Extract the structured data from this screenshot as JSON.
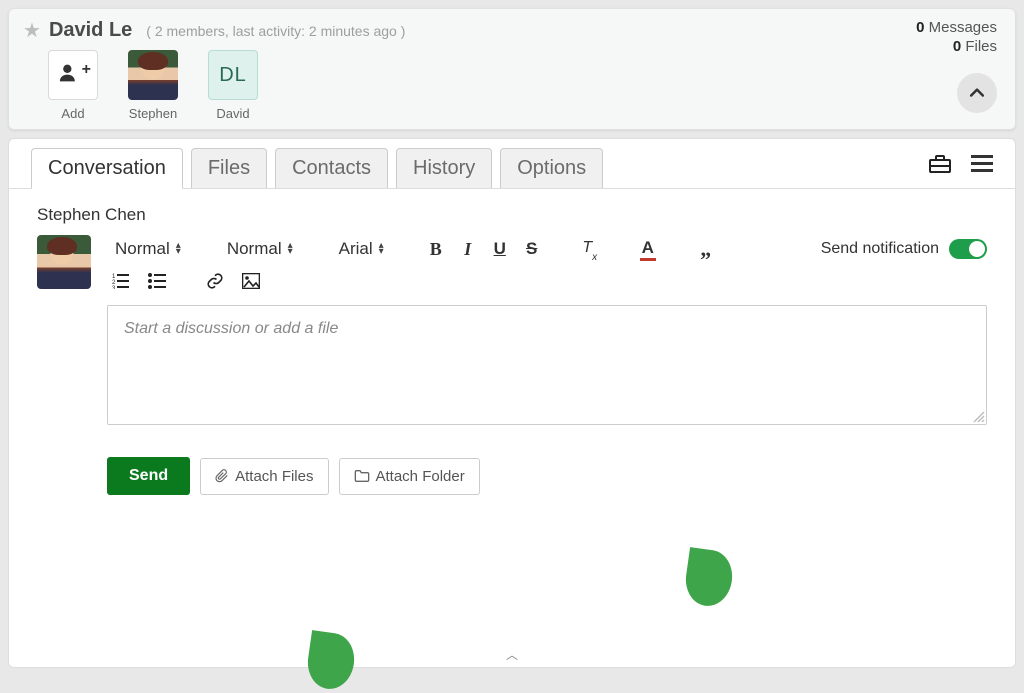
{
  "workspace": {
    "title": "David Le",
    "meta": "( 2 members, last activity: 2 minutes ago )",
    "counts": {
      "messages_num": "0",
      "messages_label": "Messages",
      "files_num": "0",
      "files_label": "Files"
    }
  },
  "members": {
    "add_label": "Add",
    "items": [
      {
        "label": "Stephen"
      },
      {
        "label": "David",
        "initials": "DL"
      }
    ]
  },
  "tabs": {
    "conversation": "Conversation",
    "files": "Files",
    "contacts": "Contacts",
    "history": "History",
    "options": "Options"
  },
  "compose": {
    "sender": "Stephen Chen",
    "style_select": "Normal",
    "size_select": "Normal",
    "font_select": "Arial",
    "notify_label": "Send notification",
    "placeholder": "Start a discussion or add a file"
  },
  "actions": {
    "send": "Send",
    "attach_files": "Attach Files",
    "attach_folder": "Attach Folder"
  }
}
